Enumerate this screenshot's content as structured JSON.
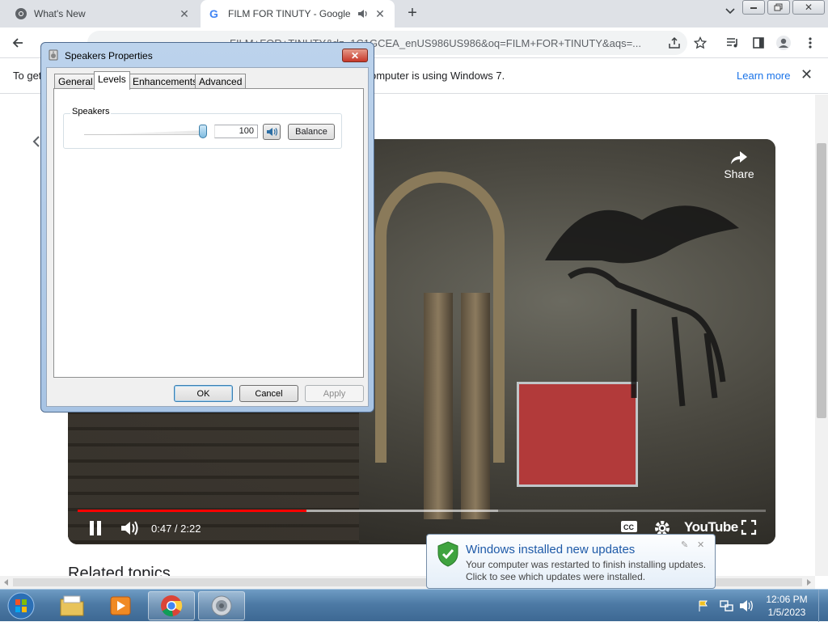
{
  "browser": {
    "tabs": [
      {
        "title": "What's New"
      },
      {
        "title": "FILM FOR TINUTY - Google"
      }
    ],
    "url": "FILM+FOR+TINUTY&rlz=1C1GCEA_enUS986US986&oq=FILM+FOR+TINUTY&aqs=...",
    "infobar": {
      "left_text": "To get",
      "right_text": "omputer is using Windows 7.",
      "learn_more": "Learn more"
    }
  },
  "page": {
    "related_heading": "Related topics"
  },
  "video": {
    "time": "0:47 / 2:22",
    "share_label": "Share",
    "logo_text": "YouTube",
    "progress_played": 0.333,
    "progress_buffered": 0.611
  },
  "dialog": {
    "title": "Speakers Properties",
    "tabs": [
      "General",
      "Levels",
      "Enhancements",
      "Advanced"
    ],
    "active_tab": "Levels",
    "group_label": "Speakers",
    "volume_value": "100",
    "volume_level": 1.0,
    "balance_label": "Balance",
    "ok_label": "OK",
    "cancel_label": "Cancel",
    "apply_label": "Apply"
  },
  "notification": {
    "title": "Windows installed new updates",
    "line1": "Your computer was restarted to finish installing updates.",
    "line2": "Click to see which updates were installed."
  },
  "taskbar": {
    "time": "12:06 PM",
    "date": "1/5/2023"
  },
  "colors": {
    "accent_blue": "#1a73e8",
    "progress_red": "#ff0000",
    "taskbar_blue": "#4d7aa5"
  }
}
